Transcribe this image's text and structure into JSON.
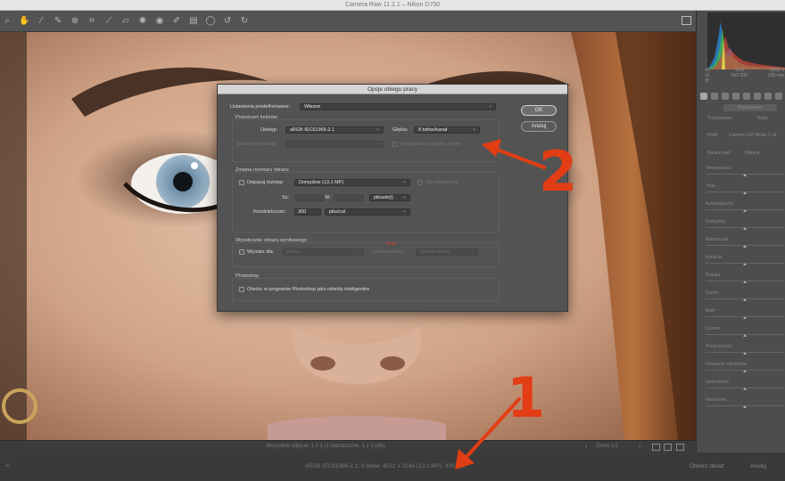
{
  "window": {
    "title": "Camera Raw 11.2.1  –  Nikon D700"
  },
  "toolbar": {
    "tools": [
      "zoom-icon",
      "hand-icon",
      "white-balance-icon",
      "color-sampler-icon",
      "target-adjust-icon",
      "crop-icon",
      "straighten-icon",
      "transform-icon",
      "spot-removal-icon",
      "red-eye-icon",
      "adjustment-brush-icon",
      "graduated-filter-icon",
      "radial-filter-icon",
      "rotate-ccw-icon",
      "rotate-cw-icon"
    ]
  },
  "canvas": {
    "filename": "Wszystkie zdjęcia: 1 z 1 (1 zaznaczone, 1 z 1 plik)",
    "zoom": "Zoom 1/1",
    "filmstrip_hint": "filmstrip"
  },
  "status": {
    "left": "..e:",
    "info": "sRGB IEC61966-2.1; 8 bitów; 4032 x 3248 (13,1 MP); 300 ppi",
    "open_button": "Otwórz obraz",
    "cancel_button": "Anuluj"
  },
  "histogram": {
    "readout": [
      {
        "label": "R:",
        "value": "---"
      },
      {
        "label": "G:",
        "value": "---"
      },
      {
        "label": "B:",
        "value": "---"
      }
    ],
    "exif": [
      "f/5,6",
      "1/200 s",
      "ISO 200",
      "105 mm"
    ]
  },
  "panel": {
    "section": "Podstawowe",
    "treatment_label": "Traktowanie:",
    "treatment_value": "Kolor",
    "profile_label": "Profil:",
    "profile_value": "Camera D4T Mode 2 v4",
    "white_balance_label": "Balans bieli:",
    "white_balance_value": "Własne",
    "sliders": [
      "Temperatura",
      "Tinta",
      "Automatyczny",
      "Domyślny",
      "Ekspozycja",
      "Kontrast",
      "Światła",
      "Cienie",
      "Białe",
      "Czarne",
      "Przejrzystość",
      "Usuwanie zamglenia",
      "Jaskrawość",
      "Nasycenie"
    ]
  },
  "dialog": {
    "title": "Opcje obiegu pracy",
    "preset_label": "Ustawienia predefiniowane:",
    "preset_value": "Własne",
    "ok_button": "OK",
    "cancel_button": "Anuluj",
    "color_space": {
      "title": "Przestrzeń kolorów",
      "space_label": "Odstęp:",
      "space_value": "sRGB IEC61966-2.1",
      "depth_label": "Głębia:",
      "depth_value": "8 bitów/kanał",
      "intent_label": "Metoda konwersji:",
      "intent_value": "",
      "bpc_label": "Kompensacja punktu czerni"
    },
    "resize": {
      "title": "Zmiana rozmiaru obrazu",
      "fit_label": "Dopasuj rozmiar:",
      "fit_value": "Domyślne (13,1 MP)",
      "no_enlarge_label": "Nie powiększaj",
      "w_label": "Sz:",
      "h_label": "W:",
      "unit_value": "piksele(i)",
      "res_label": "Rozdzielczość:",
      "res_value": "300",
      "res_unit": "piks/cal"
    },
    "sharpen": {
      "title": "Wyostrzanie obrazu wynikowego",
      "sharpen_label": "Wyostrz dla:",
      "sharpen_value": "Ekran",
      "amount_label": "Intensywność:",
      "amount_value": "Standardowa",
      "warning": "Brak"
    },
    "photoshop": {
      "title": "Photoshop",
      "smart_objects_label": "Otwórz w programie Photoshop jako obiekty inteligentne"
    }
  },
  "annotations": {
    "one": "1",
    "two": "2",
    "color": "#e23d14"
  }
}
